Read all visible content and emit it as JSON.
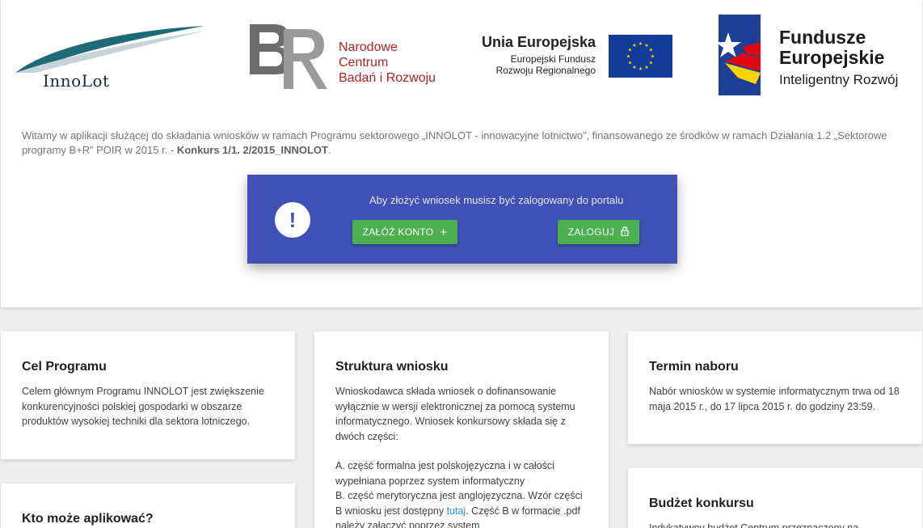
{
  "logos": {
    "innolot": "InnoLot",
    "ncbr": [
      "Narodowe Centrum",
      "Badań i Rozwoju"
    ],
    "eu": {
      "title": "Unia Europejska",
      "subtitle": [
        "Europejski Fundusz",
        "Rozwoju Regionalnego"
      ]
    },
    "fe": {
      "title": [
        "Fundusze",
        "Europejskie"
      ],
      "subtitle": "Inteligentny Rozwój"
    }
  },
  "intro": {
    "text": "Witamy w aplikacji służącej do składania wniosków w ramach Programu sektorowego „INNOLOT - innowacyjne lotnictwo”, finansowanego ze środków w ramach Działania 1.2 „Sektorowe programy B+R” POIR w 2015 r. - ",
    "contest": "Konkurs 1/1. 2/2015_INNOLOT",
    "end": "."
  },
  "login_box": {
    "icon": "!",
    "message": "Aby złożyć wniosek musisz być zalogowany do portalu",
    "register_label": "ZAŁÓŻ KONTO",
    "login_label": "ZALOGUJ"
  },
  "cards": {
    "cel": {
      "title": "Cel Programu",
      "body": "Celem głównym Programu INNOLOT jest zwiększenie konkurencyjności polskiej gospodarki w obszarze produktów wysokiej techniki dla sektora lotniczego."
    },
    "kto": {
      "title": "Kto może aplikować?"
    },
    "struktura": {
      "title": "Struktura wniosku",
      "p1": "Wnioskodawca składa wniosek o dofinansowanie wyłącznie w wersji elektronicznej za pomocą systemu informatycznego. Wniosek konkursowy składa się z dwóch części:",
      "partA": "A. część formalna jest polskojęzyczna i w całości wypełniana poprzez system informatyczny",
      "partB_start": "B. część merytoryczna jest anglojęzyczna. Wzór części B wniosku jest dostępny ",
      "link": "tutaj",
      "partB_end": ". Część B w formacie .pdf należy załączyć poprzez system"
    },
    "termin": {
      "title": "Termin naboru",
      "body": "Nabór wniosków w systemie informatycznym trwa od 18 maja 2015 r., do 17 lipca 2015 r. do godziny 23:59."
    },
    "budzet": {
      "title": "Budżet konkursu",
      "body": "Indykatywny budżet Centrum przeznaczony na"
    }
  },
  "colors": {
    "primary": "#3f51b5",
    "button": "#4caf50",
    "link": "#2196f3",
    "ncbr_red": "#b22323",
    "eu_blue": "#123c97",
    "eu_star": "#ffdd00"
  }
}
